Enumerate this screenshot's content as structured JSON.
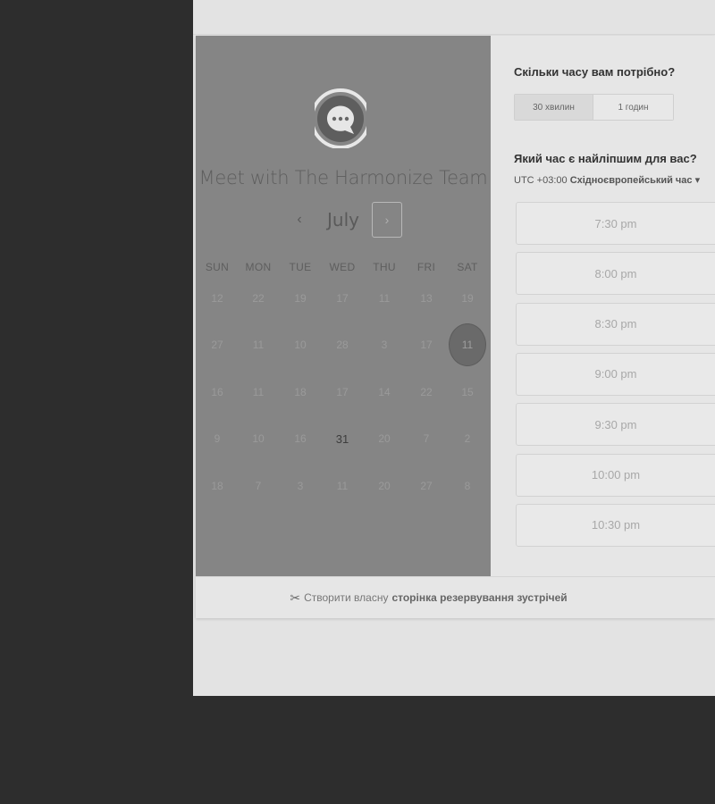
{
  "booking": {
    "team_name": "Meet with The Harmonize Team",
    "month": "July",
    "prev_icon": "‹",
    "next_icon": "›",
    "weekdays": [
      "SUN",
      "MON",
      "TUE",
      "WED",
      "THU",
      "FRI",
      "SAT"
    ],
    "weeks": [
      [
        "12",
        "22",
        "19",
        "17",
        "11",
        "13",
        "19"
      ],
      [
        "27",
        "11",
        "10",
        "28",
        "3",
        "17",
        "11"
      ],
      [
        "16",
        "11",
        "18",
        "17",
        "14",
        "22",
        "15"
      ],
      [
        "9",
        "10",
        "16",
        "31",
        "20",
        "7",
        "2"
      ],
      [
        "18",
        "7",
        "3",
        "11",
        "20",
        "27",
        "8"
      ]
    ],
    "selected_day": "11",
    "available_day": "31"
  },
  "scheduler": {
    "duration_title": "Скільки часу вам потрібно?",
    "durations": [
      "30 хвилин",
      "1 годин"
    ],
    "selected_duration": "30 хвилин",
    "time_title": "Який час є найліпшим для вас?",
    "timezone_offset": "UTC +03:00",
    "timezone_name": "Східноєвропейський час",
    "slots": [
      "7:30 pm",
      "8:00 pm",
      "8:30 pm",
      "9:00 pm",
      "9:30 pm",
      "10:00 pm",
      "10:30 pm"
    ]
  },
  "footer": {
    "icon": "scissors-icon",
    "text": "Створити власну",
    "strong": "сторінка резервування зустрічей"
  }
}
